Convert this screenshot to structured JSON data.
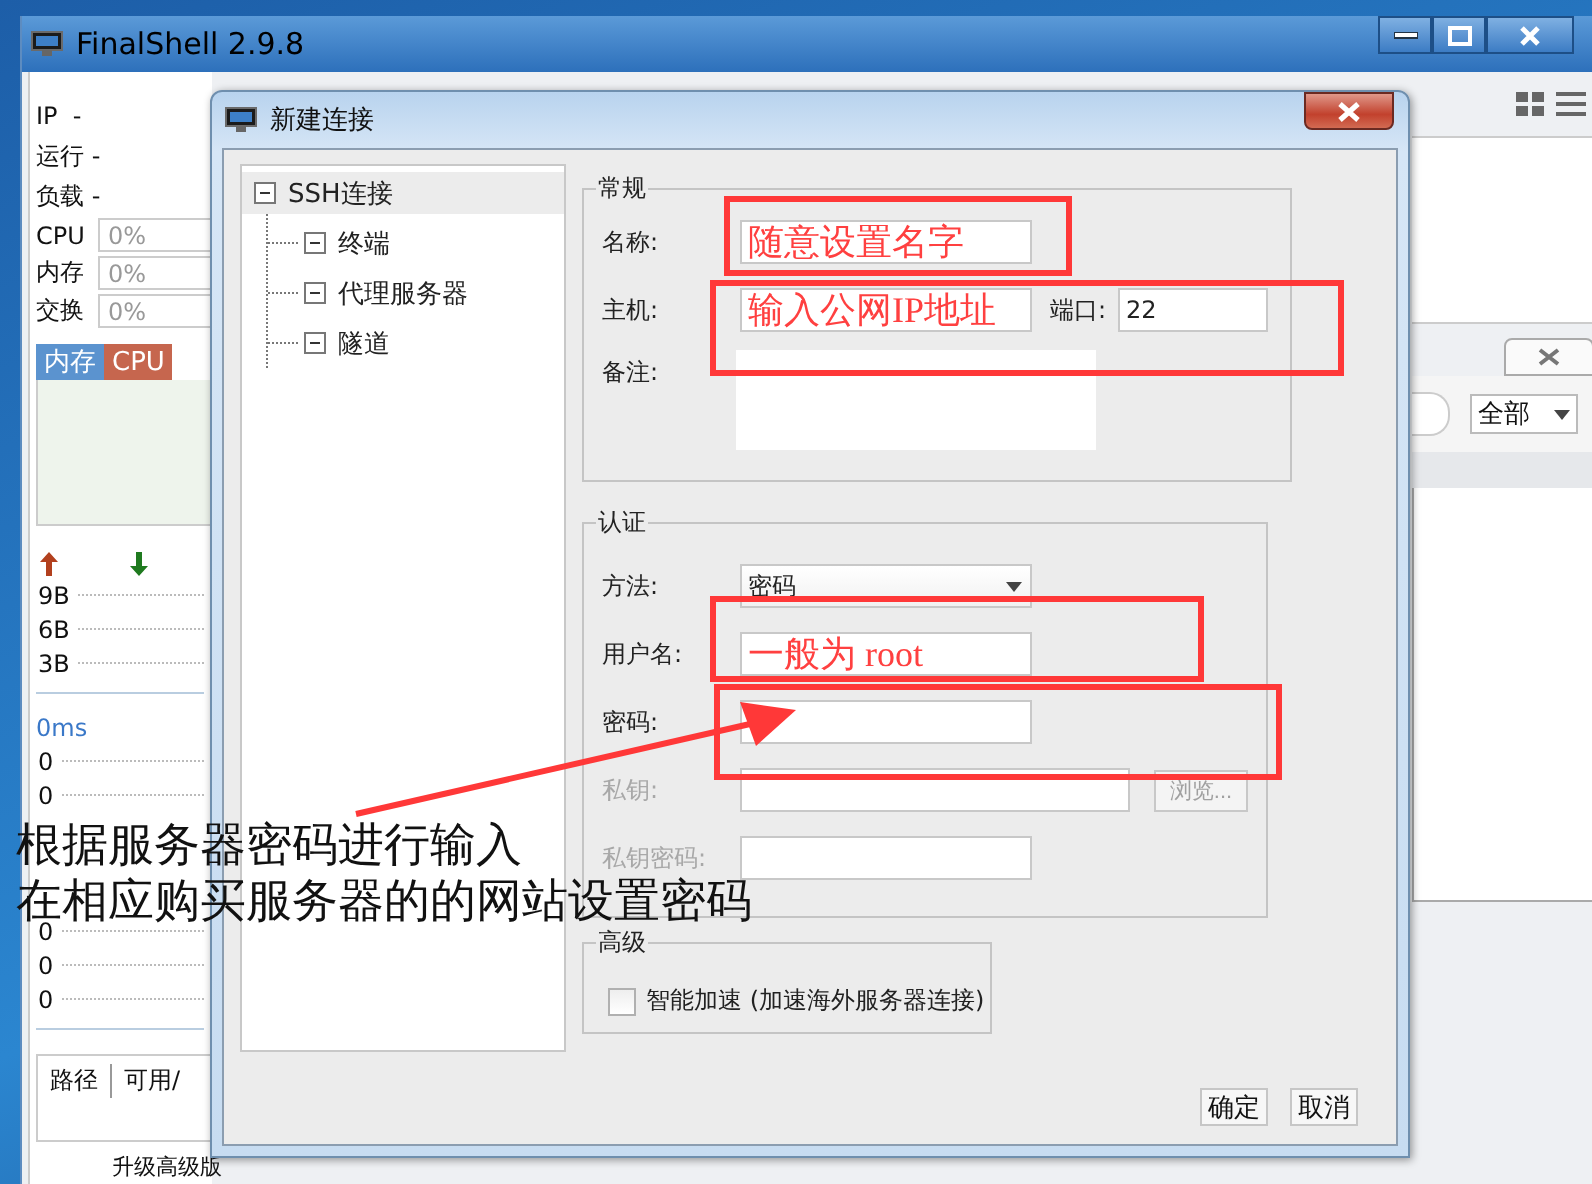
{
  "main_window": {
    "title": "FinalShell 2.9.8",
    "info": [
      "IP  -",
      "运行 -",
      "负载 -"
    ],
    "meters": [
      {
        "label": "CPU",
        "reading": "0%"
      },
      {
        "label": "内存",
        "reading": "0%"
      },
      {
        "label": "交换",
        "reading": "0%"
      }
    ],
    "chart_tabs": [
      {
        "label": "内存",
        "color": "#5b93cf"
      },
      {
        "label": "CPU",
        "color": "#c6664e"
      }
    ],
    "traffic_ticks": [
      "9B",
      "6B",
      "3B"
    ],
    "latency": [
      {
        "label": "0ms",
        "ticks": [
          "0",
          "0"
        ]
      },
      {
        "ticks": [
          "0",
          "0",
          "0"
        ]
      }
    ],
    "disk_columns": [
      "路径",
      "可用/"
    ],
    "upgrade_link": "升级高级版",
    "filter": {
      "value": "全部"
    }
  },
  "dialog": {
    "title": "新建连接",
    "tree": [
      {
        "label": "SSH连接",
        "selected": true,
        "expanded": true,
        "children": [
          {
            "label": "终端",
            "selected": false,
            "expanded": true
          },
          {
            "label": "代理服务器",
            "selected": false,
            "expanded": true
          },
          {
            "label": "隧道",
            "selected": false,
            "expanded": true
          }
        ]
      }
    ],
    "general": {
      "title": "常规",
      "fields": [
        {
          "label": "名称:",
          "value": "随意设置名字",
          "color": "#ff4040"
        },
        {
          "label": "主机:",
          "value": "输入公网IP地址",
          "color": "#ff4040"
        }
      ],
      "port": {
        "label": "端口:",
        "value": "22"
      },
      "note": {
        "label": "备注:"
      }
    },
    "auth": {
      "title": "认证",
      "method": {
        "label": "方法:",
        "value": "密码"
      },
      "fields": [
        {
          "label": "用户名:",
          "value": "一般为 root",
          "color": "#ff4040",
          "disabled": false,
          "kind": "text"
        },
        {
          "label": "密码:",
          "disabled": false,
          "kind": "text"
        },
        {
          "label": "私钥:",
          "disabled": true,
          "kind": "file"
        },
        {
          "label": "私钥密码:",
          "disabled": true,
          "kind": "text"
        }
      ],
      "browse": {
        "label": "浏览...",
        "disabled": true
      }
    },
    "advanced": {
      "title": "高级",
      "accelerate": {
        "label": "智能加速 (加速海外服务器连接)",
        "checked": false
      }
    },
    "buttons": [
      {
        "label": "确定"
      },
      {
        "label": "取消"
      }
    ]
  },
  "annotation_notes": [
    "根据服务器密码进行输入",
    "在相应购买服务器的的网站设置密码"
  ]
}
